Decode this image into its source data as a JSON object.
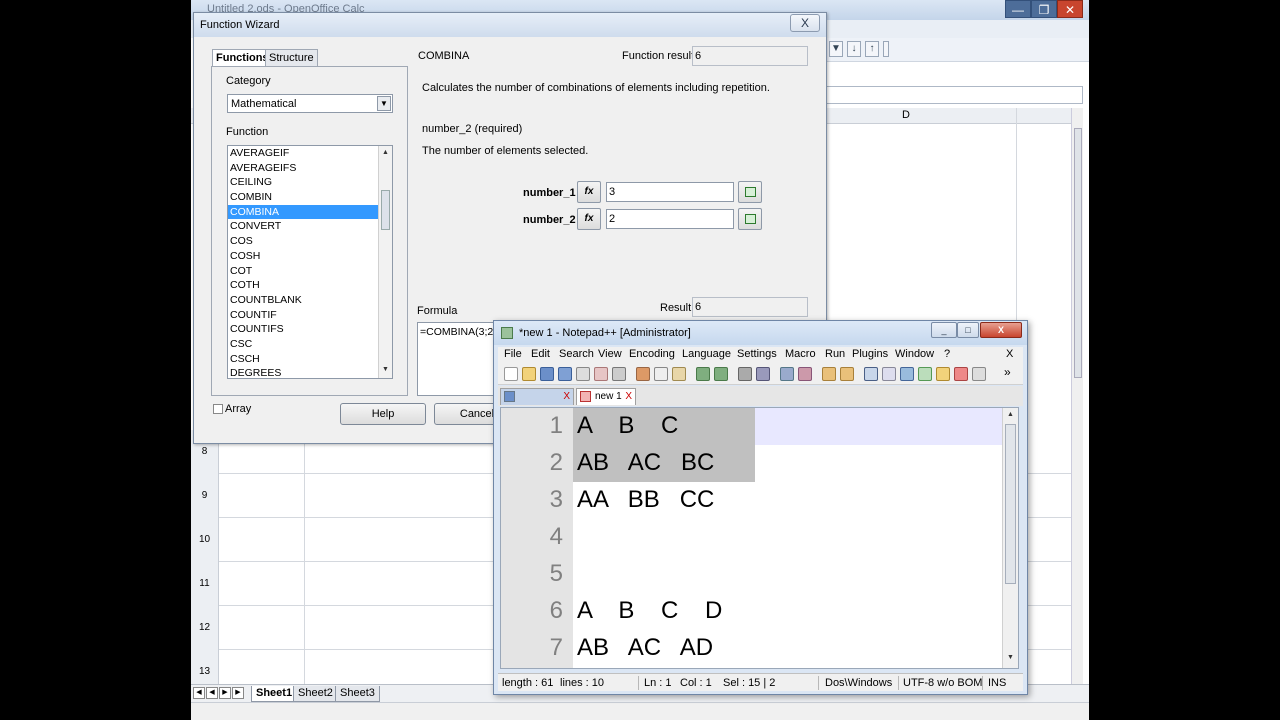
{
  "calc": {
    "window_title": "Untitled 2.ods - OpenOffice Calc",
    "column_header_d": "D",
    "row_numbers": [
      "8",
      "9",
      "10",
      "11",
      "12",
      "13"
    ],
    "sheet_tabs": [
      "Sheet1",
      "Sheet2",
      "Sheet3"
    ]
  },
  "wizard": {
    "title": "Function Wizard",
    "close_label": "X",
    "tabs": [
      "Functions",
      "Structure"
    ],
    "category_label": "Category",
    "category_value": "Mathematical",
    "function_label": "Function",
    "functions": [
      "AVERAGEIF",
      "AVERAGEIFS",
      "CEILING",
      "COMBIN",
      "COMBINA",
      "CONVERT",
      "COS",
      "COSH",
      "COT",
      "COTH",
      "COUNTBLANK",
      "COUNTIF",
      "COUNTIFS",
      "CSC",
      "CSCH",
      "DEGREES"
    ],
    "selected_function": "COMBINA",
    "function_name": "COMBINA",
    "function_result_label": "Function result",
    "function_result_value": "6",
    "description": "Calculates the number of combinations of elements including repetition.",
    "arg_heading": "number_2 (required)",
    "arg_description": "The number of elements selected.",
    "args": [
      {
        "label": "number_1",
        "value": "3"
      },
      {
        "label": "number_2",
        "value": "2"
      }
    ],
    "fx_label": "fx",
    "formula_label": "Formula",
    "result_label": "Result",
    "result_value": "6",
    "formula_text": "=COMBINA(3;2",
    "array_label": "Array",
    "help_label": "Help",
    "cancel_label": "Cancel"
  },
  "npp": {
    "title": "*new  1 - Notepad++ [Administrator]",
    "window_buttons": [
      "_",
      "□",
      "X"
    ],
    "menu": [
      "File",
      "Edit",
      "Search",
      "View",
      "Encoding",
      "Language",
      "Settings",
      "Macro",
      "Run",
      "Plugins",
      "Window",
      "?"
    ],
    "menu_close": "X",
    "tabs": [
      "",
      "new  1"
    ],
    "tab_close": "X",
    "toolbar_more": "»",
    "lines": [
      {
        "num": "1",
        "text": "A    B    C"
      },
      {
        "num": "2",
        "text": "AB   AC   BC"
      },
      {
        "num": "3",
        "text": "AA   BB   CC"
      },
      {
        "num": "4",
        "text": ""
      },
      {
        "num": "5",
        "text": ""
      },
      {
        "num": "6",
        "text": "A    B    C    D"
      },
      {
        "num": "7",
        "text": "AB   AC   AD"
      }
    ],
    "status": {
      "length": "length : 61",
      "lines": "lines : 10",
      "ln": "Ln : 1",
      "col": "Col : 1",
      "sel": "Sel : 15 | 2",
      "eol": "Dos\\Windows",
      "encoding": "UTF-8 w/o BOM",
      "mode": "INS"
    }
  },
  "colors": {
    "selection": "#3399ff",
    "npp_current_line": "#e8e8ff",
    "npp_selection": "#c0c0c0"
  }
}
